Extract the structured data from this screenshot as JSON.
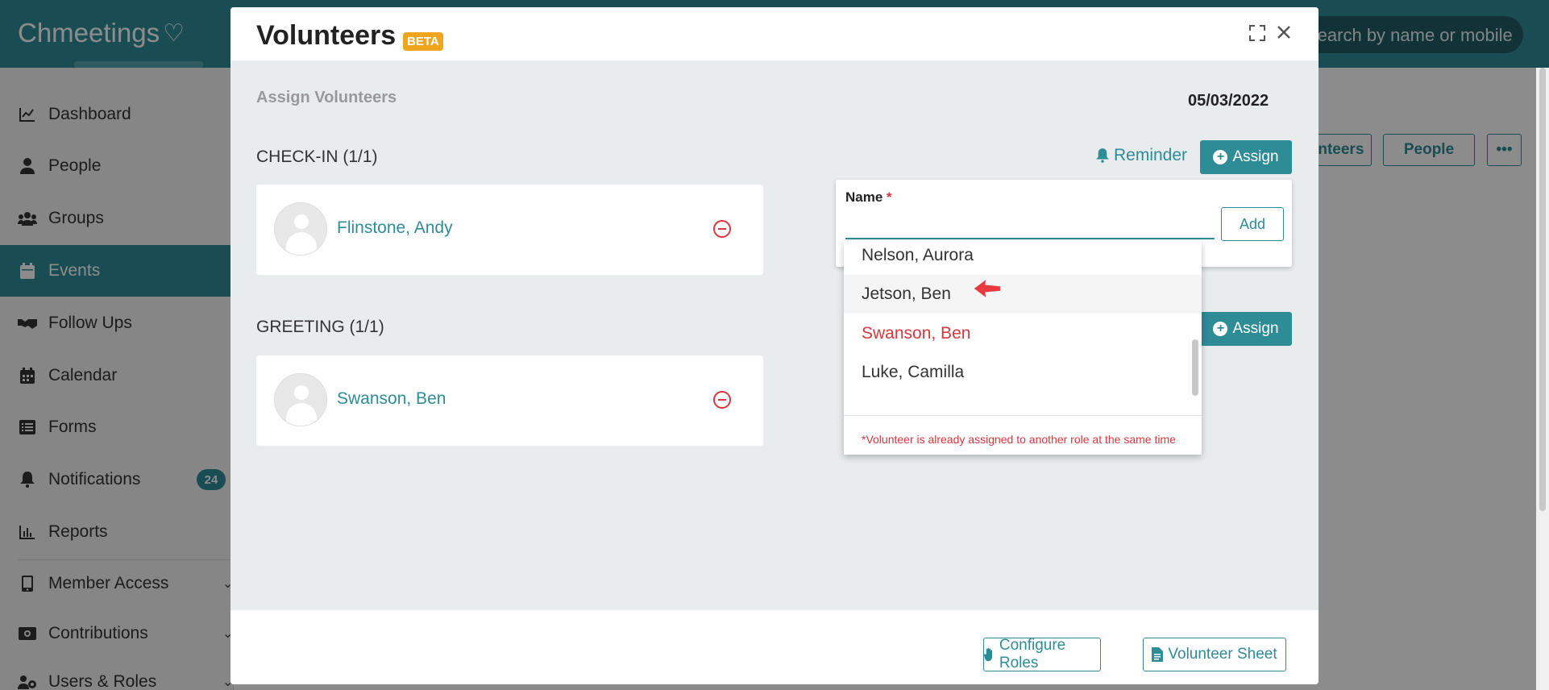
{
  "app": {
    "logo_text": "Chmeetings",
    "search_placeholder": "Search by name or mobile"
  },
  "sidebar": {
    "items": [
      {
        "label": "Dashboard",
        "icon": "chart-line-icon"
      },
      {
        "label": "People",
        "icon": "user-icon"
      },
      {
        "label": "Groups",
        "icon": "users-icon"
      },
      {
        "label": "Events",
        "icon": "calendar-icon",
        "active": true
      },
      {
        "label": "Follow Ups",
        "icon": "handshake-icon"
      },
      {
        "label": "Calendar",
        "icon": "calendar-grid-icon"
      },
      {
        "label": "Forms",
        "icon": "list-icon"
      },
      {
        "label": "Notifications",
        "icon": "bell-icon",
        "badge": "24"
      },
      {
        "label": "Reports",
        "icon": "bar-chart-icon"
      },
      {
        "label": "Member Access",
        "icon": "mobile-icon"
      },
      {
        "label": "Contributions",
        "icon": "money-icon"
      },
      {
        "label": "Users & Roles",
        "icon": "users-cog-icon"
      }
    ]
  },
  "background": {
    "volunteers_btn": "Volunteers",
    "people_btn": "People",
    "more_btn": "•••"
  },
  "modal": {
    "title": "Volunteers",
    "beta": "BETA",
    "subtitle": "Assign Volunteers",
    "date": "05/03/2022",
    "reminder_label": "Reminder",
    "assign_label": "Assign",
    "sections": [
      {
        "label": "CHECK-IN (1/1)",
        "volunteer": "Flinstone, Andy"
      },
      {
        "label": "GREETING (1/1)",
        "volunteer": "Swanson, Ben"
      }
    ],
    "footer": {
      "configure_roles": "Configure Roles",
      "volunteer_sheet": "Volunteer Sheet"
    }
  },
  "assign_popup": {
    "name_label": "Name",
    "required_mark": "*",
    "input_value": "",
    "add_label": "Add",
    "options": [
      {
        "label": "Nelson, Aurora",
        "state": "normal"
      },
      {
        "label": "Jetson, Ben",
        "state": "highlighted"
      },
      {
        "label": "Swanson, Ben",
        "state": "conflict"
      },
      {
        "label": "Luke, Camilla",
        "state": "normal"
      }
    ],
    "note": "*Volunteer is already assigned to another role at the same time"
  },
  "colors": {
    "teal": "#2e8c97",
    "danger": "#d9363e",
    "beta": "#f0a51e"
  }
}
